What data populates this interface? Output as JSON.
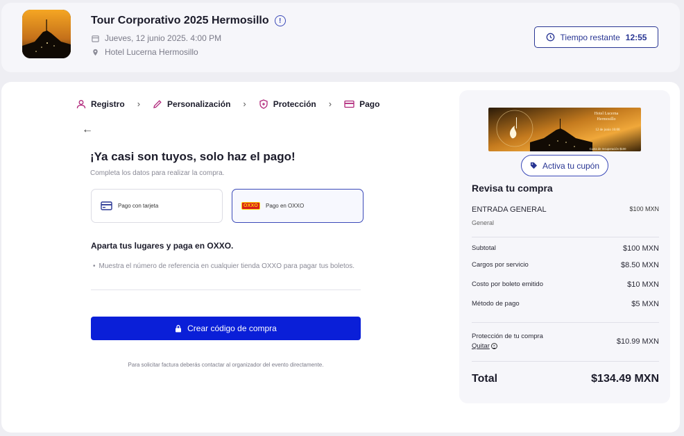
{
  "event": {
    "title": "Tour Corporativo 2025 Hermosillo",
    "date": "Jueves, 12 junio 2025. 4:00 PM",
    "location": "Hotel Lucerna Hermosillo"
  },
  "timer": {
    "label": "Tiempo restante",
    "value": "12:55"
  },
  "steps": [
    {
      "label": "Registro"
    },
    {
      "label": "Personalización"
    },
    {
      "label": "Protección"
    },
    {
      "label": "Pago"
    }
  ],
  "checkout": {
    "heading": "¡Ya casi son tuyos, solo haz el pago!",
    "subheading": "Completa los datos para realizar la compra.",
    "payment_options": [
      {
        "label": "Pago con tarjeta",
        "selected": false
      },
      {
        "label": "Pago en OXXO",
        "selected": true
      }
    ],
    "oxxo_logo_text": "OXXO",
    "section_title": "Aparta tus lugares y paga en OXXO.",
    "bullet": "Muestra el número de referencia en cualquier tienda OXXO para pagar tus boletos.",
    "cta_label": "Crear código de compra",
    "footnote": "Para solicitar factura deberás contactar al organizador del evento directamente."
  },
  "banner": {
    "venue_line1": "Hotel Lucerna",
    "venue_line2": "Hermosillo",
    "date": "12 de junio 16:00",
    "fee": "Cuota de recuperación $100"
  },
  "summary": {
    "coupon_label": "Activa tu cupón",
    "title": "Revisa tu compra",
    "ticket": {
      "name": "ENTRADA GENERAL",
      "sub": "General",
      "price": "$100 MXN"
    },
    "lines": [
      {
        "label": "Subtotal",
        "value": "$100 MXN"
      },
      {
        "label": "Cargos por servicio",
        "value": "$8.50 MXN"
      },
      {
        "label": "Costo por boleto emitido",
        "value": "$10 MXN"
      },
      {
        "label": "Método de pago",
        "value": "$5 MXN"
      }
    ],
    "protection": {
      "label": "Protección de tu compra",
      "remove": "Quitar",
      "value": "$10.99 MXN"
    },
    "total": {
      "label": "Total",
      "value": "$134.49 MXN"
    }
  },
  "colors": {
    "accent": "#283593",
    "cta": "#0a1fd8",
    "step_icon": "#b0267a"
  }
}
